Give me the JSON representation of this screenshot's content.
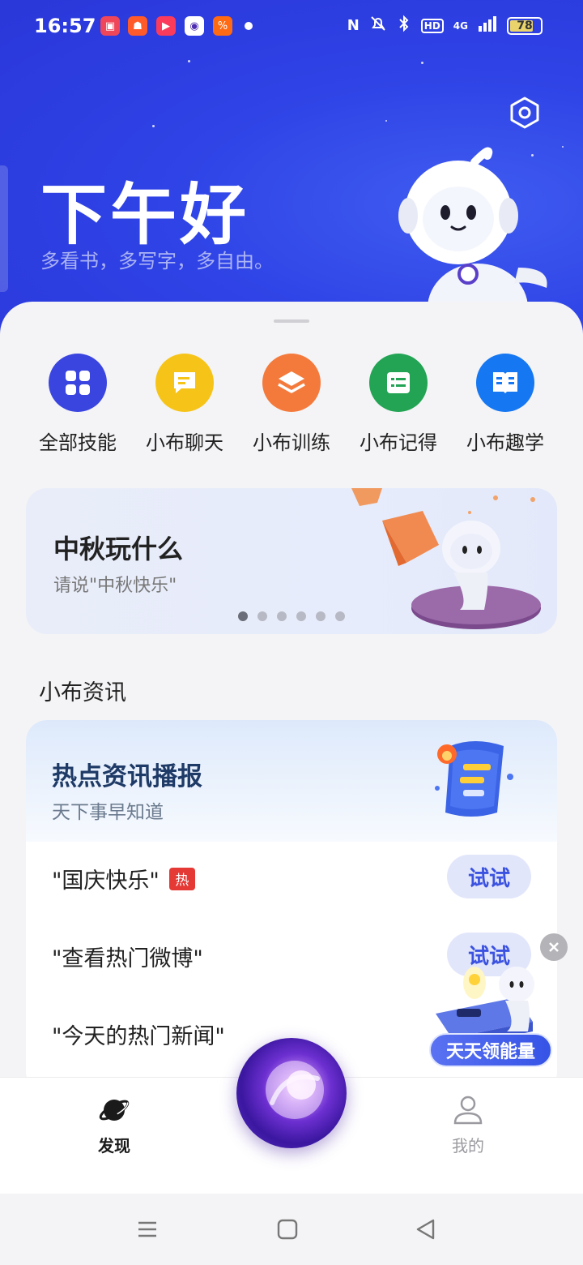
{
  "status_bar": {
    "time": "16:57",
    "network": "4G",
    "battery": "78",
    "battery_level_percent": 78,
    "hd_label": "HD",
    "icons": [
      "nfc-icon",
      "mute-icon",
      "bluetooth-icon",
      "hd-icon",
      "signal-icon",
      "battery-icon"
    ]
  },
  "header": {
    "greeting": "下午好",
    "subtitle": "多看书，多写字，多自由。"
  },
  "skills": [
    {
      "label": "全部技能",
      "icon": "grid-icon",
      "color": "#3a45e0"
    },
    {
      "label": "小布聊天",
      "icon": "chat-icon",
      "color": "#f6c419"
    },
    {
      "label": "小布训练",
      "icon": "layers-icon",
      "color": "#f47a3c"
    },
    {
      "label": "小布记得",
      "icon": "list-icon",
      "color": "#22a454"
    },
    {
      "label": "小布趣学",
      "icon": "book-icon",
      "color": "#1677f2"
    }
  ],
  "banner": {
    "title": "中秋玩什么",
    "subtitle": "请说\"中秋快乐\"",
    "page_count": 6,
    "active_page": 1
  },
  "news": {
    "section_title": "小布资讯",
    "card_title": "热点资讯播报",
    "card_subtitle": "天下事早知道",
    "items": [
      {
        "text": "\"国庆快乐\"",
        "badge": "热",
        "action": "试试"
      },
      {
        "text": "\"查看热门微博\"",
        "action": "试试"
      },
      {
        "text": "\"今天的热门新闻\""
      }
    ]
  },
  "promo": {
    "label": "天天领能量"
  },
  "bottom_nav": {
    "discover": "发现",
    "mine": "我的"
  },
  "colors": {
    "header_blue": "#2f43e6",
    "accent": "#3b52e0",
    "hot_red": "#e53935"
  }
}
